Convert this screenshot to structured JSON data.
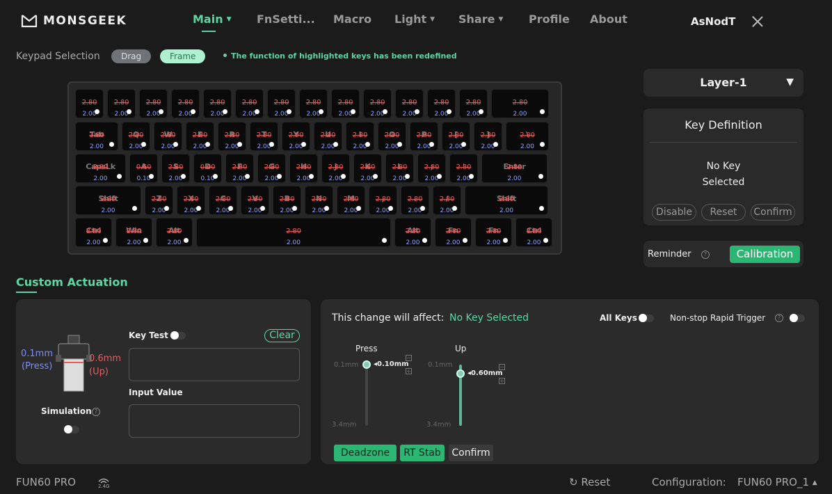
{
  "header": {
    "brand": "MONSGEEK",
    "nav": [
      {
        "label": "Main",
        "dropdown": true,
        "active": true
      },
      {
        "label": "FnSetti...",
        "dropdown": false,
        "active": false
      },
      {
        "label": "Macro",
        "dropdown": false,
        "active": false
      },
      {
        "label": "Light",
        "dropdown": true,
        "active": false
      },
      {
        "label": "Share",
        "dropdown": true,
        "active": false
      },
      {
        "label": "Profile",
        "dropdown": false,
        "active": false
      },
      {
        "label": "About",
        "dropdown": false,
        "active": false
      }
    ],
    "user": "AsNodT"
  },
  "keypad": {
    "label": "Keypad Selection",
    "drag": "Drag",
    "frame": "Frame",
    "notice": "The function of highlighted keys has been redefined"
  },
  "keyboard": {
    "rows": [
      [
        {
          "legend": "",
          "press": "2.80",
          "up": "2.00"
        },
        {
          "legend": "",
          "press": "2.80",
          "up": "2.00"
        },
        {
          "legend": "",
          "press": "2.80",
          "up": "2.00"
        },
        {
          "legend": "",
          "press": "2.80",
          "up": "2.00"
        },
        {
          "legend": "",
          "press": "2.80",
          "up": "2.00"
        },
        {
          "legend": "",
          "press": "2.80",
          "up": "2.00"
        },
        {
          "legend": "",
          "press": "2.80",
          "up": "2.00"
        },
        {
          "legend": "",
          "press": "2.80",
          "up": "2.00"
        },
        {
          "legend": "",
          "press": "2.80",
          "up": "2.00"
        },
        {
          "legend": "",
          "press": "2.80",
          "up": "2.00"
        },
        {
          "legend": "",
          "press": "2.80",
          "up": "2.00"
        },
        {
          "legend": "",
          "press": "2.80",
          "up": "2.00"
        },
        {
          "legend": "",
          "press": "2.80",
          "up": "2.00"
        },
        {
          "legend": "",
          "press": "2.80",
          "up": "2.00"
        }
      ],
      [
        {
          "legend": "Tab",
          "press": "2.80",
          "up": "2.00"
        },
        {
          "legend": "Q",
          "press": "2.80",
          "up": "2.00"
        },
        {
          "legend": "W",
          "press": "2.80",
          "up": "2.00"
        },
        {
          "legend": "E",
          "press": "2.80",
          "up": "2.00"
        },
        {
          "legend": "R",
          "press": "2.80",
          "up": "2.00"
        },
        {
          "legend": "T",
          "press": "2.80",
          "up": "2.00"
        },
        {
          "legend": "Y",
          "press": "2.80",
          "up": "2.00"
        },
        {
          "legend": "U",
          "press": "2.80",
          "up": "2.00"
        },
        {
          "legend": "I",
          "press": "2.80",
          "up": "2.00"
        },
        {
          "legend": "O",
          "press": "2.80",
          "up": "2.00"
        },
        {
          "legend": "P",
          "press": "2.80",
          "up": "2.00"
        },
        {
          "legend": "[",
          "press": "2.80",
          "up": "2.00"
        },
        {
          "legend": "]",
          "press": "2.80",
          "up": "2.00"
        },
        {
          "legend": "\\",
          "press": "2.80",
          "up": "2.00"
        }
      ],
      [
        {
          "legend": "CapsLk",
          "press": "2.80",
          "up": "2.00"
        },
        {
          "legend": "A",
          "press": "0.60",
          "up": "0.10"
        },
        {
          "legend": "S",
          "press": "2.80",
          "up": "2.00"
        },
        {
          "legend": "D",
          "press": "0.60",
          "up": "0.10"
        },
        {
          "legend": "F",
          "press": "2.80",
          "up": "2.00"
        },
        {
          "legend": "G",
          "press": "2.80",
          "up": "2.00"
        },
        {
          "legend": "H",
          "press": "2.80",
          "up": "2.00"
        },
        {
          "legend": "J",
          "press": "2.80",
          "up": "2.00"
        },
        {
          "legend": "K",
          "press": "2.80",
          "up": "2.00"
        },
        {
          "legend": "L",
          "press": "2.80",
          "up": "2.00"
        },
        {
          "legend": ";",
          "press": "2.80",
          "up": "2.00"
        },
        {
          "legend": "'",
          "press": "2.80",
          "up": "2.00"
        },
        {
          "legend": "Enter",
          "press": "2.80",
          "up": "2.00"
        }
      ],
      [
        {
          "legend": "Shift",
          "press": "2.80",
          "up": "2.00"
        },
        {
          "legend": "Z",
          "press": "2.80",
          "up": "2.00"
        },
        {
          "legend": "X",
          "press": "2.80",
          "up": "2.00"
        },
        {
          "legend": "C",
          "press": "2.80",
          "up": "2.00"
        },
        {
          "legend": "V",
          "press": "2.80",
          "up": "2.00"
        },
        {
          "legend": "B",
          "press": "2.80",
          "up": "2.00"
        },
        {
          "legend": "N",
          "press": "2.80",
          "up": "2.00"
        },
        {
          "legend": "M",
          "press": "2.80",
          "up": "2.00"
        },
        {
          "legend": ",",
          "press": "2.80",
          "up": "2.00"
        },
        {
          "legend": ".",
          "press": "2.80",
          "up": "2.00"
        },
        {
          "legend": "/",
          "press": "2.80",
          "up": "2.00"
        },
        {
          "legend": "Shift",
          "press": "2.80",
          "up": "2.00"
        }
      ],
      [
        {
          "legend": "Ctrl",
          "press": "2.80",
          "up": "2.00"
        },
        {
          "legend": "Win",
          "press": "2.80",
          "up": "2.00"
        },
        {
          "legend": "Alt",
          "press": "2.80",
          "up": "2.00"
        },
        {
          "legend": "",
          "press": "2.80",
          "up": "2.00"
        },
        {
          "legend": "Alt",
          "press": "2.80",
          "up": "2.00"
        },
        {
          "legend": "Fn",
          "press": "2.80",
          "up": "2.00"
        },
        {
          "legend": "Fn",
          "press": "2.80",
          "up": "2.00"
        },
        {
          "legend": "Ctrl",
          "press": "2.80",
          "up": "2.00"
        }
      ]
    ]
  },
  "right_panel": {
    "layer": "Layer-1",
    "key_def_title": "Key Definition",
    "no_key_line1": "No Key",
    "no_key_line2": "Selected",
    "disable": "Disable",
    "reset": "Reset",
    "confirm": "Confirm",
    "reminder": "Reminder",
    "calibration": "Calibration"
  },
  "custom_actuation": {
    "title": "Custom Actuation",
    "switch": {
      "press_value": "0.1mm",
      "press_label": "(Press)",
      "up_value": "0.6mm",
      "up_label": "(Up)"
    },
    "simulation": "Simulation",
    "key_test": "Key Test",
    "clear": "Clear",
    "input_value": "Input Value",
    "affect_label": "This change will affect:",
    "affect_value": "No Key Selected",
    "all_keys": "All Keys",
    "rapid_trigger": "Non-stop Rapid Trigger",
    "press": {
      "title": "Press",
      "min": "0.1mm",
      "max": "3.4mm",
      "value": "0.10mm",
      "level": 0.0
    },
    "up": {
      "title": "Up",
      "min": "0.1mm",
      "max": "3.4mm",
      "value": "0.60mm",
      "level": 0.15
    },
    "deadzone": "Deadzone",
    "rt_stab": "RT Stab",
    "confirm": "Confirm"
  },
  "footer": {
    "device": "FUN60 PRO",
    "wireless": "2.4G",
    "reset": "Reset",
    "config_label": "Configuration:",
    "config_value": "FUN60 PRO_1"
  },
  "colors": {
    "accent": "#5fd4a3",
    "button_green": "#2bb673",
    "press_red": "#e06060",
    "up_blue": "#8fa0ff"
  }
}
